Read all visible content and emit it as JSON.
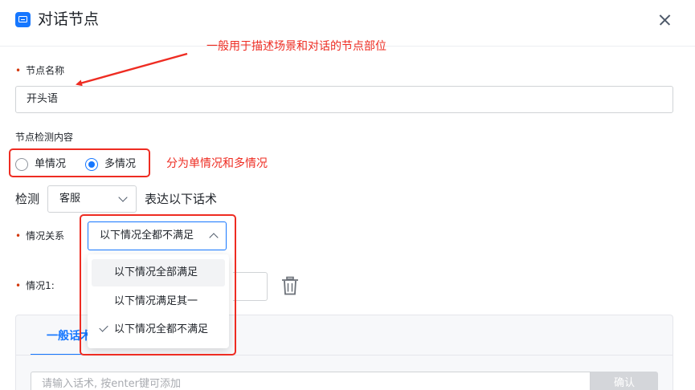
{
  "dialog": {
    "title": "对话节点",
    "icon": "chat-node-icon",
    "close_icon": "close-icon"
  },
  "annotations": {
    "node_name_note": "一般用于描述场景和对话的节点部位",
    "mode_note": "分为单情况和多情况",
    "color": "#ee2c22"
  },
  "form": {
    "node_name": {
      "label": "节点名称",
      "required_mark": "•",
      "value": "开头语"
    },
    "detection_section": {
      "label": "节点检测内容",
      "modes": [
        {
          "label": "单情况",
          "checked": false
        },
        {
          "label": "多情况",
          "checked": true
        }
      ]
    },
    "detect_row": {
      "prefix": "检测",
      "role_select": "客服",
      "suffix": "表达以下话术"
    },
    "relation": {
      "label": "情况关系",
      "required_mark": "•",
      "selected": "以下情况全都不满足",
      "options": [
        {
          "label": "以下情况全部满足",
          "selected": false,
          "hovered": true
        },
        {
          "label": "以下情况满足其一",
          "selected": false,
          "hovered": false
        },
        {
          "label": "以下情况全都不满足",
          "selected": true,
          "hovered": false
        }
      ]
    },
    "condition1": {
      "label": "情况1:",
      "required_mark": "•",
      "delete_icon": "trash-icon"
    },
    "phrase_panel": {
      "tab_label": "一般话术",
      "placeholder": "请输入话术, 按enter键可添加",
      "confirm_label": "确认"
    }
  },
  "colors": {
    "primary": "#1677ff",
    "required": "#d4380d",
    "disabled_button": "#d4d6da"
  }
}
